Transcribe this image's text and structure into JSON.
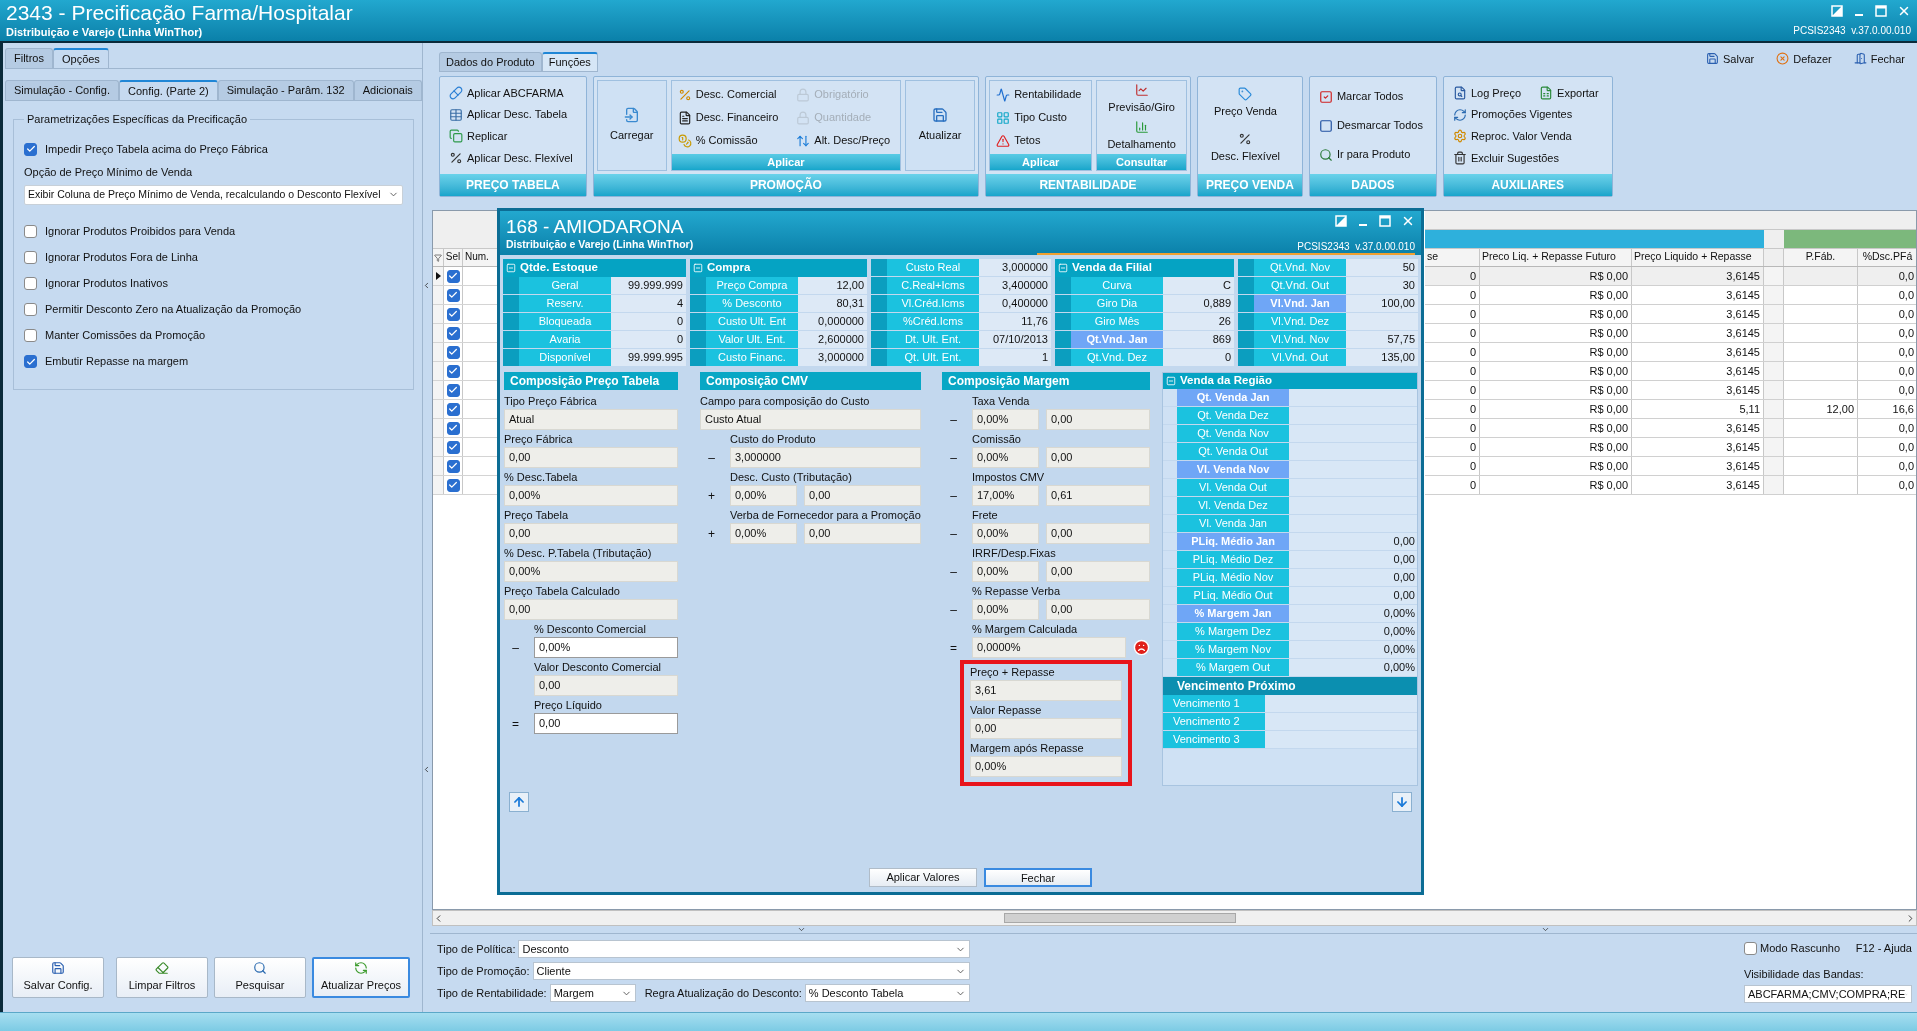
{
  "window": {
    "title": "2343 - Precificação Farma/Hospitalar",
    "subtitle": "Distribuição e Varejo (Linha WinThor)",
    "version": "PCSIS2343  v.37.0.00.010"
  },
  "left_panel": {
    "tabs": [
      {
        "label": "Filtros",
        "selected": false
      },
      {
        "label": "Opções",
        "selected": true
      }
    ],
    "subtabs": [
      {
        "label": "Simulação - Config.",
        "selected": false
      },
      {
        "label": "Config. (Parte 2)",
        "selected": true
      },
      {
        "label": "Simulação - Parâm. 132",
        "selected": false
      },
      {
        "label": "Adicionais",
        "selected": false
      }
    ],
    "group": {
      "title": "Parametrizações Específicas da Precificação",
      "options": [
        {
          "kind": "checkbox",
          "label": "Impedir Preço Tabela acima do Preço Fábrica",
          "checked": true
        },
        {
          "kind": "select",
          "label": "Opção de Preço Mínimo de Venda",
          "value": "Exibir Coluna de Preço Mínimo de Venda, recalculando o Desconto Flexível"
        },
        {
          "kind": "checkbox",
          "label": "Ignorar Produtos Proibidos para Venda",
          "checked": false
        },
        {
          "kind": "checkbox",
          "label": "Ignorar Produtos Fora de Linha",
          "checked": false
        },
        {
          "kind": "checkbox",
          "label": "Ignorar Produtos Inativos",
          "checked": false
        },
        {
          "kind": "checkbox",
          "label": "Permitir Desconto Zero na Atualização da Promoção",
          "checked": false
        },
        {
          "kind": "checkbox",
          "label": "Manter Comissões da Promoção",
          "checked": false
        },
        {
          "kind": "checkbox",
          "label": "Embutir Repasse na margem",
          "checked": true
        }
      ]
    },
    "buttons": [
      {
        "label": "Salvar Config.",
        "focused": false
      },
      {
        "label": "Limpar Filtros",
        "focused": false
      },
      {
        "label": "Pesquisar",
        "focused": false
      },
      {
        "label": "Atualizar Preços",
        "focused": true
      }
    ]
  },
  "tabs": [
    {
      "label": "Dados do Produto",
      "selected": false
    },
    {
      "label": "Funções",
      "selected": true
    }
  ],
  "actions": [
    "Salvar",
    "Defazer",
    "Fechar"
  ],
  "ribbon": [
    {
      "title": "PREÇO TABELA",
      "sections": [
        {
          "kind": "rows",
          "rows": [
            [
              {
                "label": "Aplicar ABCFARMA"
              }
            ],
            [
              {
                "label": "Aplicar Desc. Tabela"
              }
            ],
            [
              {
                "label": "Replicar"
              }
            ],
            [
              {
                "label": "Aplicar Desc. Flexível"
              }
            ]
          ]
        }
      ]
    },
    {
      "title": "PROMOÇÃO",
      "sections": [
        {
          "kind": "large",
          "label": "Carregar"
        },
        {
          "kind": "rows",
          "caption": "Aplicar",
          "rows": [
            [
              {
                "label": "Desc. Comercial",
                "disabled": false
              },
              {
                "label": "Obrigatório",
                "disabled": true
              }
            ],
            [
              {
                "label": "Desc. Financeiro",
                "disabled": false
              },
              {
                "label": "Quantidade",
                "disabled": true
              }
            ],
            [
              {
                "label": "% Comissão",
                "disabled": false
              },
              {
                "label": "Alt. Desc/Preço",
                "disabled": false
              }
            ]
          ]
        },
        {
          "kind": "large",
          "label": "Atualizar"
        }
      ]
    },
    {
      "title": "RENTABILIDADE",
      "sections": [
        {
          "kind": "rows",
          "caption": "Aplicar",
          "rows": [
            [
              {
                "label": "Rentabilidade"
              }
            ],
            [
              {
                "label": "Tipo Custo"
              }
            ],
            [
              {
                "label": "Tetos"
              }
            ]
          ]
        },
        {
          "kind": "stack",
          "caption": "Consultar",
          "items": [
            {
              "label": "Previsão/Giro"
            },
            {
              "label": "Detalhamento"
            }
          ]
        }
      ]
    },
    {
      "title": "PREÇO VENDA",
      "sections": [
        {
          "kind": "stack",
          "items": [
            {
              "label": "Preço Venda"
            },
            {
              "label": "Desc. Flexível"
            }
          ]
        }
      ]
    },
    {
      "title": "DADOS",
      "sections": [
        {
          "kind": "rows",
          "rows": [
            [
              {
                "label": "Marcar Todos"
              }
            ],
            [
              {
                "label": "Desmarcar Todos"
              }
            ],
            [
              {
                "label": "Ir para Produto"
              }
            ]
          ]
        }
      ]
    },
    {
      "title": "AUXILIARES",
      "sections": [
        {
          "kind": "rows",
          "rows": [
            [
              {
                "label": "Log Preço"
              },
              {
                "label": "Exportar"
              }
            ],
            [
              {
                "label": "Promoções Vigentes"
              }
            ],
            [
              {
                "label": "Reproc. Valor Venda"
              }
            ],
            [
              {
                "label": "Excluir Sugestões"
              }
            ]
          ]
        }
      ]
    }
  ],
  "grid": {
    "left_columns": [
      {
        "label": "Sel"
      },
      {
        "label": "Num."
      }
    ],
    "right_columns": [
      {
        "kind": "data",
        "label": "se"
      },
      {
        "kind": "data",
        "label": "Preco Liq. + Repasse Futuro"
      },
      {
        "kind": "data",
        "label": "Preço Liquido + Repasse"
      },
      {
        "kind": "spacer"
      },
      {
        "kind": "data",
        "label": "P.Fáb."
      },
      {
        "kind": "data",
        "label": "%Dsc.PFá"
      }
    ],
    "rows": [
      {
        "current": true,
        "checked": true,
        "cells": [
          "0",
          "R$ 0,00",
          "3,6145",
          null,
          "0,0"
        ]
      },
      {
        "current": false,
        "checked": true,
        "cells": [
          "0",
          "R$ 0,00",
          "3,6145",
          null,
          "0,0"
        ]
      },
      {
        "current": false,
        "checked": true,
        "cells": [
          "0",
          "R$ 0,00",
          "3,6145",
          null,
          "0,0"
        ]
      },
      {
        "current": false,
        "checked": true,
        "cells": [
          "0",
          "R$ 0,00",
          "3,6145",
          null,
          "0,0"
        ]
      },
      {
        "current": false,
        "checked": true,
        "cells": [
          "0",
          "R$ 0,00",
          "3,6145",
          null,
          "0,0"
        ]
      },
      {
        "current": false,
        "checked": true,
        "cells": [
          "0",
          "R$ 0,00",
          "3,6145",
          null,
          "0,0"
        ]
      },
      {
        "current": false,
        "checked": true,
        "cells": [
          "0",
          "R$ 0,00",
          "3,6145",
          null,
          "0,0"
        ]
      },
      {
        "current": false,
        "checked": true,
        "cells": [
          "0",
          "R$ 0,00",
          "5,11",
          "12,00",
          "16,6"
        ]
      },
      {
        "current": false,
        "checked": true,
        "cells": [
          "0",
          "R$ 0,00",
          "3,6145",
          null,
          "0,0"
        ]
      },
      {
        "current": false,
        "checked": true,
        "cells": [
          "0",
          "R$ 0,00",
          "3,6145",
          null,
          "0,0"
        ]
      },
      {
        "current": false,
        "checked": true,
        "cells": [
          "0",
          "R$ 0,00",
          "3,6145",
          null,
          "0,0"
        ]
      },
      {
        "current": false,
        "checked": true,
        "cells": [
          "0",
          "R$ 0,00",
          "3,6145",
          null,
          "0,0"
        ]
      }
    ]
  },
  "dialog": {
    "title": "168 - AMIODARONA",
    "subtitle": "Distribuição e Varejo (Linha WinThor)",
    "version": "PCSIS2343  v.37.0.00.010",
    "stat_panels": [
      {
        "title": "Qtde. Estoque",
        "rows": [
          {
            "label": "Geral",
            "value": "99.999.999",
            "highlighted": false
          },
          {
            "label": "Reserv.",
            "value": "4",
            "highlighted": false
          },
          {
            "label": "Bloqueada",
            "value": "0",
            "highlighted": false
          },
          {
            "label": "Avaria",
            "value": "0",
            "highlighted": false
          },
          {
            "label": "Disponível",
            "value": "99.999.995",
            "highlighted": false
          }
        ]
      },
      {
        "title": "Compra",
        "rows": [
          {
            "label": "Preço Compra",
            "value": "12,00",
            "highlighted": false
          },
          {
            "label": "% Desconto",
            "value": "80,31",
            "highlighted": false
          },
          {
            "label": "Custo Ult. Ent",
            "value": "0,000000",
            "highlighted": false
          },
          {
            "label": "Valor Ult. Ent.",
            "value": "2,600000",
            "highlighted": false
          },
          {
            "label": "Custo Financ.",
            "value": "3,000000",
            "highlighted": false
          }
        ]
      },
      {
        "rows": [
          {
            "label": "Custo Real",
            "value": "3,000000",
            "highlighted": false
          },
          {
            "label": "C.Real+Icms",
            "value": "3,400000",
            "highlighted": false
          },
          {
            "label": "Vl.Créd.Icms",
            "value": "0,400000",
            "highlighted": false
          },
          {
            "label": "%Créd.Icms",
            "value": "11,76",
            "highlighted": false
          },
          {
            "label": "Dt. Ult. Ent.",
            "value": "07/10/2013",
            "highlighted": false
          },
          {
            "label": "Qt. Ult. Ent.",
            "value": "1",
            "highlighted": false
          }
        ]
      },
      {
        "title": "Venda da Filial",
        "rows": [
          {
            "label": "Curva",
            "value": "C",
            "highlighted": false
          },
          {
            "label": "Giro Dia",
            "value": "0,889",
            "highlighted": false
          },
          {
            "label": "Giro Mês",
            "value": "26",
            "highlighted": false
          },
          {
            "label": "Qt.Vnd. Jan",
            "value": "869",
            "highlighted": true
          },
          {
            "label": "Qt.Vnd. Dez",
            "value": "0",
            "highlighted": false
          }
        ]
      },
      {
        "rows": [
          {
            "label": "Qt.Vnd. Nov",
            "value": "50",
            "highlighted": false
          },
          {
            "label": "Qt.Vnd. Out",
            "value": "30",
            "highlighted": false
          },
          {
            "label": "Vl.Vnd. Jan",
            "value": "100,00",
            "highlighted": true
          },
          {
            "label": "Vl.Vnd. Dez",
            "highlighted": false
          },
          {
            "label": "Vl.Vnd. Nov",
            "value": "57,75",
            "highlighted": false
          },
          {
            "label": "Vl.Vnd. Out",
            "value": "135,00",
            "highlighted": false
          }
        ]
      }
    ],
    "sections": [
      {
        "title": "Composição Preço Tabela",
        "fields": [
          {
            "label": "Tipo Preço Fábrica",
            "indented": false,
            "editable": false,
            "values": [
              "Atual"
            ]
          },
          {
            "label": "Preço Fábrica",
            "indented": false,
            "editable": false,
            "values": [
              "0,00"
            ]
          },
          {
            "label": "% Desc.Tabela",
            "indented": false,
            "editable": false,
            "values": [
              "0,00%"
            ]
          },
          {
            "label": "Preço Tabela",
            "indented": false,
            "editable": false,
            "values": [
              "0,00"
            ]
          },
          {
            "label": "% Desc. P.Tabela (Tributação)",
            "indented": false,
            "editable": false,
            "values": [
              "0,00%"
            ]
          },
          {
            "label": "Preço Tabela Calculado",
            "indented": false,
            "editable": false,
            "values": [
              "0,00"
            ]
          },
          {
            "label": "% Desconto Comercial",
            "sign": "–",
            "indented": true,
            "editable": true,
            "values": [
              "0,00%"
            ]
          },
          {
            "label": "Valor Desconto Comercial",
            "indented": true,
            "editable": false,
            "values": [
              "0,00"
            ]
          },
          {
            "label": "Preço Líquido",
            "sign": "=",
            "indented": true,
            "editable": true,
            "values": [
              "0,00"
            ]
          }
        ]
      },
      {
        "title": "Composição CMV",
        "fields": [
          {
            "label": "Campo para composição do Custo",
            "indented": false,
            "editable": false,
            "values": [
              "Custo Atual"
            ]
          },
          {
            "label": "Custo do Produto",
            "sign": "–",
            "indented": true,
            "editable": false,
            "values": [
              "3,000000"
            ]
          },
          {
            "label": "Desc. Custo (Tributação)",
            "sign": "+",
            "indented": true,
            "editable": false,
            "values": [
              "0,00%",
              "0,00"
            ]
          },
          {
            "label": "Verba de Fornecedor para a Promoção",
            "sign": "+",
            "indented": true,
            "editable": false,
            "values": [
              "0,00%",
              "0,00"
            ]
          }
        ]
      },
      {
        "title": "Composição Margem",
        "fields": [
          {
            "label": "Taxa Venda",
            "sign": "–",
            "indented": true,
            "editable": false,
            "warning": false,
            "values": [
              "0,00%",
              "0,00"
            ]
          },
          {
            "label": "Comissão",
            "sign": "–",
            "indented": true,
            "editable": false,
            "warning": false,
            "values": [
              "0,00%",
              "0,00"
            ]
          },
          {
            "label": "Impostos CMV",
            "sign": "–",
            "indented": true,
            "editable": false,
            "warning": false,
            "values": [
              "17,00%",
              "0,61"
            ]
          },
          {
            "label": "Frete",
            "sign": "–",
            "indented": true,
            "editable": false,
            "warning": false,
            "values": [
              "0,00%",
              "0,00"
            ]
          },
          {
            "label": "IRRF/Desp.Fixas",
            "sign": "–",
            "indented": true,
            "editable": false,
            "warning": false,
            "values": [
              "0,00%",
              "0,00"
            ]
          },
          {
            "label": "% Repasse Verba",
            "sign": "–",
            "indented": true,
            "editable": false,
            "warning": false,
            "values": [
              "0,00%",
              "0,00"
            ]
          },
          {
            "label": "% Margem Calculada",
            "sign": "=",
            "indented": true,
            "editable": false,
            "values": [
              "0,0000%"
            ],
            "warning": true
          }
        ],
        "highlight_box": {
          "fields": [
            {
              "label": "Preço + Repasse",
              "indented": false,
              "editable": false,
              "values": [
                "3,61"
              ]
            },
            {
              "label": "Valor Repasse",
              "indented": false,
              "editable": false,
              "values": [
                "0,00"
              ]
            },
            {
              "label": "Margem após Repasse",
              "indented": false,
              "editable": false,
              "values": [
                "0,00%"
              ]
            }
          ]
        }
      }
    ],
    "region": {
      "title": "Venda da Região",
      "rows": [
        {
          "label": "Qt. Venda Jan",
          "highlighted": true
        },
        {
          "label": "Qt. Venda Dez",
          "highlighted": false
        },
        {
          "label": "Qt. Venda Nov",
          "highlighted": false
        },
        {
          "label": "Qt. Venda Out",
          "highlighted": false
        },
        {
          "label": "Vl. Venda Nov",
          "highlighted": true
        },
        {
          "label": "Vl. Venda Out",
          "highlighted": false
        },
        {
          "label": "Vl. Venda Dez",
          "highlighted": false
        },
        {
          "label": "Vl. Venda Jan",
          "highlighted": false
        },
        {
          "label": "PLiq. Médio Jan",
          "value": "0,00",
          "highlighted": true
        },
        {
          "label": "PLiq. Médio Dez",
          "value": "0,00",
          "highlighted": false
        },
        {
          "label": "PLiq. Médio Nov",
          "value": "0,00",
          "highlighted": false
        },
        {
          "label": "PLiq. Médio Out",
          "value": "0,00",
          "highlighted": false
        },
        {
          "label": "% Margem Jan",
          "value": "0,00%",
          "highlighted": true
        },
        {
          "label": "% Margem Dez",
          "value": "0,00%",
          "highlighted": false
        },
        {
          "label": "% Margem Nov",
          "value": "0,00%",
          "highlighted": false
        },
        {
          "label": "% Margem Out",
          "value": "0,00%",
          "highlighted": false
        }
      ],
      "due_title": "Vencimento Próximo",
      "due_rows": [
        {
          "label": "Vencimento 1"
        },
        {
          "label": "Vencimento 2"
        },
        {
          "label": "Vencimento 3"
        }
      ]
    },
    "buttons": [
      {
        "label": "Aplicar Valores",
        "focused": false
      },
      {
        "label": "Fechar",
        "focused": true
      }
    ]
  },
  "filters": [
    {
      "label": "Tipo de Política:",
      "value": "Desconto"
    },
    {
      "label": "Tipo de Promoção:",
      "value": "Cliente"
    }
  ],
  "rent_row": {
    "label": "Tipo de Rentabilidade:",
    "value": "Margem",
    "rule_label": "Regra Atualização do Desconto:",
    "rule_value": "% Desconto Tabela"
  },
  "draft": {
    "label": "Modo Rascunho",
    "checked": false
  },
  "help": "F12 - Ajuda",
  "bands": {
    "label": "Visibilidade das Bandas:",
    "value": "ABCFARMA;CMV;COMPRA;RE"
  }
}
